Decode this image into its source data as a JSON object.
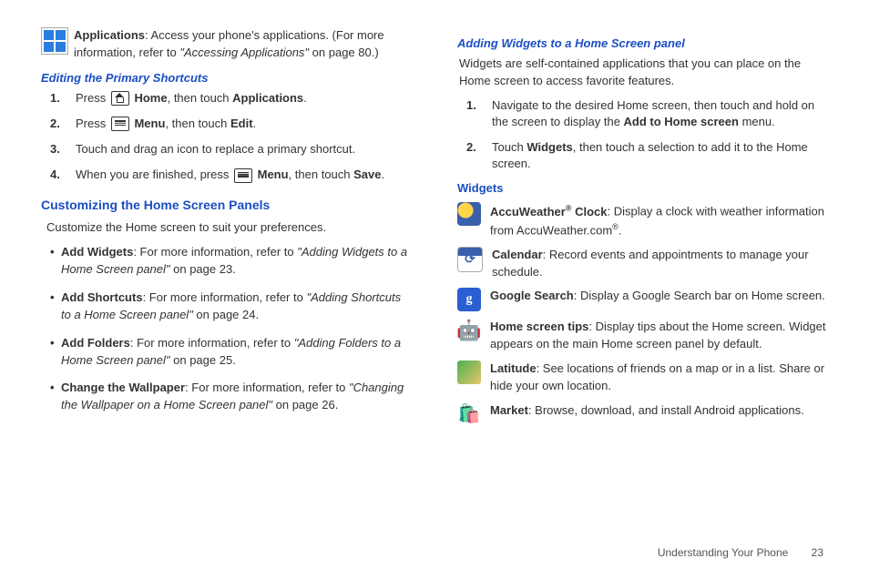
{
  "left": {
    "apps_desc_prefix": "Applications",
    "apps_desc_text": ": Access your phone's applications. (For more information, refer to ",
    "apps_desc_ref": "\"Accessing Applications\"",
    "apps_desc_suffix": " on page 80.)",
    "editing_heading": "Editing the Primary Shortcuts",
    "steps": {
      "s1_a": "Press ",
      "s1_home": "Home",
      "s1_b": ", then touch ",
      "s1_apps": "Applications",
      "s1_c": ".",
      "s2_a": "Press ",
      "s2_menu": "Menu",
      "s2_b": ", then touch ",
      "s2_edit": "Edit",
      "s2_c": ".",
      "s3": "Touch and drag an icon to replace a primary shortcut.",
      "s4_a": "When you are finished, press ",
      "s4_menu": "Menu",
      "s4_b": ", then touch ",
      "s4_save": "Save",
      "s4_c": "."
    },
    "custom_heading": "Customizing the Home Screen Panels",
    "custom_intro": "Customize the Home screen to suit your preferences.",
    "bullets": {
      "b1_t": "Add Widgets",
      "b1_a": ": For more information, refer to ",
      "b1_r": "\"Adding Widgets to a Home Screen panel\"",
      "b1_s": " on page 23.",
      "b2_t": "Add Shortcuts",
      "b2_a": ": For more information, refer to ",
      "b2_r": "\"Adding Shortcuts to a Home Screen panel\"",
      "b2_s": " on page 24.",
      "b3_t": "Add Folders",
      "b3_a": ": For more information, refer to ",
      "b3_r": "\"Adding Folders to a Home Screen panel\"",
      "b3_s": " on page 25.",
      "b4_t": "Change the Wallpaper",
      "b4_a": ": For more information, refer to ",
      "b4_r": "\"Changing the Wallpaper on a Home Screen panel\"",
      "b4_s": " on page 26."
    }
  },
  "right": {
    "add_widgets_heading": "Adding Widgets to a Home Screen panel",
    "widgets_intro": "Widgets are self-contained applications that you can place on the Home screen to access favorite features.",
    "rs1_a": "Navigate to the desired Home screen, then touch and hold on the screen to display the ",
    "rs1_b": "Add to Home screen",
    "rs1_c": " menu.",
    "rs2_a": "Touch ",
    "rs2_b": "Widgets",
    "rs2_c": ", then touch a selection to add it to the Home screen.",
    "widgets_label": "Widgets",
    "w1_t1": "AccuWeather",
    "w1_t2": " Clock",
    "w1_d": ": Display a clock with weather information from AccuWeather.com",
    "w1_e": ".",
    "w2_t": "Calendar",
    "w2_d": ": Record events and appointments to manage your schedule.",
    "w3_t": "Google Search",
    "w3_d": ": Display a Google Search bar on Home screen.",
    "w4_t": "Home screen tips",
    "w4_d": ": Display tips about the Home screen. Widget appears on the main Home screen panel by default.",
    "w5_t": "Latitude",
    "w5_d": ": See locations of friends on a map or in a list. Share or hide your own location.",
    "w6_t": "Market",
    "w6_d": ": Browse, download, and install Android applications."
  },
  "footer": {
    "section": "Understanding Your Phone",
    "page": "23"
  },
  "nums": {
    "n1": "1.",
    "n2": "2.",
    "n3": "3.",
    "n4": "4."
  }
}
